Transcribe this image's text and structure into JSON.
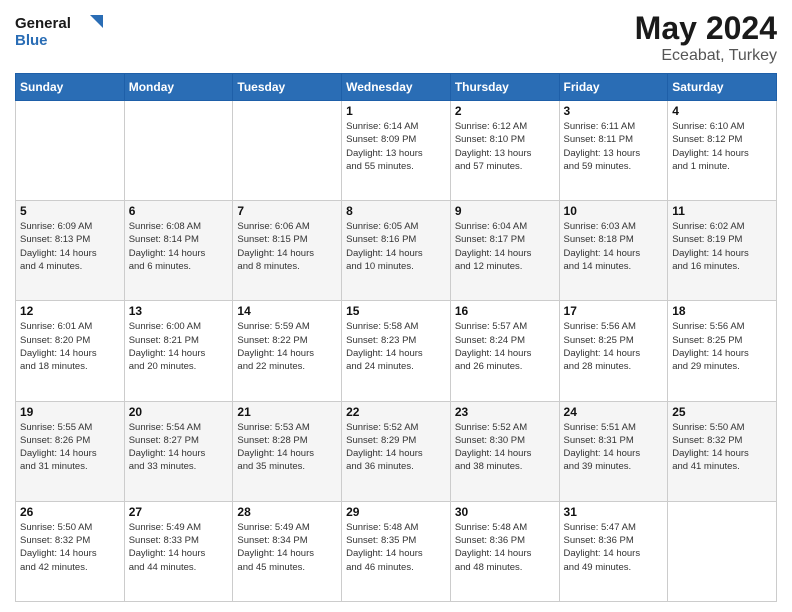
{
  "header": {
    "logo_text_general": "General",
    "logo_text_blue": "Blue",
    "month": "May 2024",
    "location": "Eceabat, Turkey"
  },
  "days_of_week": [
    "Sunday",
    "Monday",
    "Tuesday",
    "Wednesday",
    "Thursday",
    "Friday",
    "Saturday"
  ],
  "weeks": [
    [
      {
        "day": "",
        "info": ""
      },
      {
        "day": "",
        "info": ""
      },
      {
        "day": "",
        "info": ""
      },
      {
        "day": "1",
        "info": "Sunrise: 6:14 AM\nSunset: 8:09 PM\nDaylight: 13 hours\nand 55 minutes."
      },
      {
        "day": "2",
        "info": "Sunrise: 6:12 AM\nSunset: 8:10 PM\nDaylight: 13 hours\nand 57 minutes."
      },
      {
        "day": "3",
        "info": "Sunrise: 6:11 AM\nSunset: 8:11 PM\nDaylight: 13 hours\nand 59 minutes."
      },
      {
        "day": "4",
        "info": "Sunrise: 6:10 AM\nSunset: 8:12 PM\nDaylight: 14 hours\nand 1 minute."
      }
    ],
    [
      {
        "day": "5",
        "info": "Sunrise: 6:09 AM\nSunset: 8:13 PM\nDaylight: 14 hours\nand 4 minutes."
      },
      {
        "day": "6",
        "info": "Sunrise: 6:08 AM\nSunset: 8:14 PM\nDaylight: 14 hours\nand 6 minutes."
      },
      {
        "day": "7",
        "info": "Sunrise: 6:06 AM\nSunset: 8:15 PM\nDaylight: 14 hours\nand 8 minutes."
      },
      {
        "day": "8",
        "info": "Sunrise: 6:05 AM\nSunset: 8:16 PM\nDaylight: 14 hours\nand 10 minutes."
      },
      {
        "day": "9",
        "info": "Sunrise: 6:04 AM\nSunset: 8:17 PM\nDaylight: 14 hours\nand 12 minutes."
      },
      {
        "day": "10",
        "info": "Sunrise: 6:03 AM\nSunset: 8:18 PM\nDaylight: 14 hours\nand 14 minutes."
      },
      {
        "day": "11",
        "info": "Sunrise: 6:02 AM\nSunset: 8:19 PM\nDaylight: 14 hours\nand 16 minutes."
      }
    ],
    [
      {
        "day": "12",
        "info": "Sunrise: 6:01 AM\nSunset: 8:20 PM\nDaylight: 14 hours\nand 18 minutes."
      },
      {
        "day": "13",
        "info": "Sunrise: 6:00 AM\nSunset: 8:21 PM\nDaylight: 14 hours\nand 20 minutes."
      },
      {
        "day": "14",
        "info": "Sunrise: 5:59 AM\nSunset: 8:22 PM\nDaylight: 14 hours\nand 22 minutes."
      },
      {
        "day": "15",
        "info": "Sunrise: 5:58 AM\nSunset: 8:23 PM\nDaylight: 14 hours\nand 24 minutes."
      },
      {
        "day": "16",
        "info": "Sunrise: 5:57 AM\nSunset: 8:24 PM\nDaylight: 14 hours\nand 26 minutes."
      },
      {
        "day": "17",
        "info": "Sunrise: 5:56 AM\nSunset: 8:25 PM\nDaylight: 14 hours\nand 28 minutes."
      },
      {
        "day": "18",
        "info": "Sunrise: 5:56 AM\nSunset: 8:25 PM\nDaylight: 14 hours\nand 29 minutes."
      }
    ],
    [
      {
        "day": "19",
        "info": "Sunrise: 5:55 AM\nSunset: 8:26 PM\nDaylight: 14 hours\nand 31 minutes."
      },
      {
        "day": "20",
        "info": "Sunrise: 5:54 AM\nSunset: 8:27 PM\nDaylight: 14 hours\nand 33 minutes."
      },
      {
        "day": "21",
        "info": "Sunrise: 5:53 AM\nSunset: 8:28 PM\nDaylight: 14 hours\nand 35 minutes."
      },
      {
        "day": "22",
        "info": "Sunrise: 5:52 AM\nSunset: 8:29 PM\nDaylight: 14 hours\nand 36 minutes."
      },
      {
        "day": "23",
        "info": "Sunrise: 5:52 AM\nSunset: 8:30 PM\nDaylight: 14 hours\nand 38 minutes."
      },
      {
        "day": "24",
        "info": "Sunrise: 5:51 AM\nSunset: 8:31 PM\nDaylight: 14 hours\nand 39 minutes."
      },
      {
        "day": "25",
        "info": "Sunrise: 5:50 AM\nSunset: 8:32 PM\nDaylight: 14 hours\nand 41 minutes."
      }
    ],
    [
      {
        "day": "26",
        "info": "Sunrise: 5:50 AM\nSunset: 8:32 PM\nDaylight: 14 hours\nand 42 minutes."
      },
      {
        "day": "27",
        "info": "Sunrise: 5:49 AM\nSunset: 8:33 PM\nDaylight: 14 hours\nand 44 minutes."
      },
      {
        "day": "28",
        "info": "Sunrise: 5:49 AM\nSunset: 8:34 PM\nDaylight: 14 hours\nand 45 minutes."
      },
      {
        "day": "29",
        "info": "Sunrise: 5:48 AM\nSunset: 8:35 PM\nDaylight: 14 hours\nand 46 minutes."
      },
      {
        "day": "30",
        "info": "Sunrise: 5:48 AM\nSunset: 8:36 PM\nDaylight: 14 hours\nand 48 minutes."
      },
      {
        "day": "31",
        "info": "Sunrise: 5:47 AM\nSunset: 8:36 PM\nDaylight: 14 hours\nand 49 minutes."
      },
      {
        "day": "",
        "info": ""
      }
    ]
  ]
}
